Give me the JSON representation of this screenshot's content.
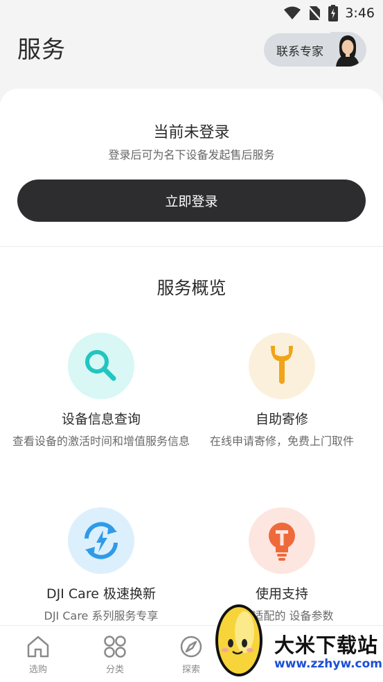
{
  "status_bar": {
    "time": "3:46"
  },
  "header": {
    "title": "服务",
    "contact_label": "联系专家"
  },
  "login": {
    "title": "当前未登录",
    "subtitle": "登录后可为名下设备发起售后服务",
    "button_label": "立即登录"
  },
  "overview": {
    "title": "服务概览",
    "items": [
      {
        "title": "设备信息查询",
        "desc": "查看设备的激活时间和增值服务信息",
        "icon": "magnifier-icon",
        "color": "#23c5c0",
        "bg": "#d8f7f5"
      },
      {
        "title": "自助寄修",
        "desc": "在线申请寄修，免费上门取件",
        "icon": "wrench-icon",
        "color": "#f0a418",
        "bg": "#fbf0dc"
      },
      {
        "title": "DJI Care 极速换新",
        "desc": "DJI Care 系列服务专享",
        "icon": "refresh-bolt-icon",
        "color": "#2f9be8",
        "bg": "#dceffc"
      },
      {
        "title": "使用支持",
        "desc": "查询适配的        设备参数",
        "icon": "lightbulb-icon",
        "color": "#ef6a3a",
        "bg": "#fde6e0"
      }
    ]
  },
  "nav": {
    "items": [
      {
        "label": "选购",
        "icon": "home-icon"
      },
      {
        "label": "分类",
        "icon": "grid-icon"
      },
      {
        "label": "探索",
        "icon": "compass-icon"
      }
    ]
  },
  "watermark": {
    "text": "大米下载站",
    "url": "www.zzhyw.com"
  }
}
